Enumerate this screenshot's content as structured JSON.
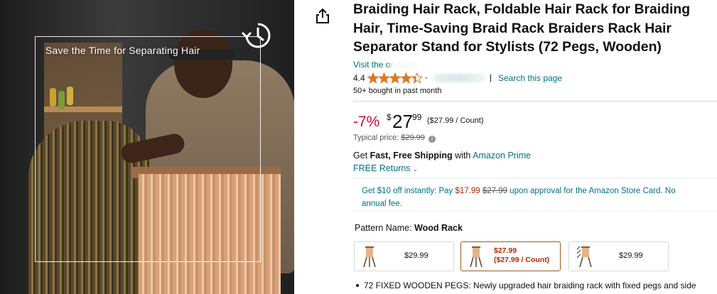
{
  "hero": {
    "caption": "Save the Time for Separating Hair"
  },
  "share": {
    "icon": "share-icon"
  },
  "product": {
    "title": "Braiding Hair Rack, Foldable Hair Rack for Braiding Hair, Time-Saving Braid Rack Braiders Rack Hair Separator Stand for Stylists (72 Pegs, Wooden)",
    "store_link": "Visit the          on Store",
    "rating": "4.4",
    "rating_stars_fraction": 0.88,
    "pipe": "|",
    "search_page": "Search this page",
    "bought": "50+ bought in past month"
  },
  "price": {
    "discount": "-7%",
    "symbol": "$",
    "whole": "27",
    "fraction": "99",
    "per_unit": "($27.99 / Count)",
    "typical_label": "Typical price:",
    "typical_value": "$29.99",
    "info_icon": "i"
  },
  "shipping": {
    "prefix": "Get ",
    "bold": "Fast, Free Shipping",
    "middle": " with ",
    "prime": "Amazon Prime",
    "returns": "FREE Returns",
    "returns_caret": "⌄"
  },
  "promo": {
    "part1": "Get $10 off instantly: Pay ",
    "price": "$17.99",
    "space": " ",
    "old_price": "$27.99",
    "part2": " upon approval for the Amazon Store Card. No annual fee."
  },
  "pattern": {
    "label": "Pattern Name: ",
    "value": "Wood Rack",
    "options": [
      {
        "price": "$29.99"
      },
      {
        "price_line1": "$27.99",
        "price_line2": "($27.99 / Count)"
      },
      {
        "price": "$29.99"
      }
    ]
  },
  "bullets": [
    "72 FIXED WOODEN PEGS: Newly upgraded hair braiding rack with fixed pegs and side"
  ],
  "colors": {
    "link": "#007185",
    "deal_red": "#CC0C39",
    "price_red": "#B12704",
    "star": "#DE7921",
    "selected_border": "#a6571c"
  }
}
